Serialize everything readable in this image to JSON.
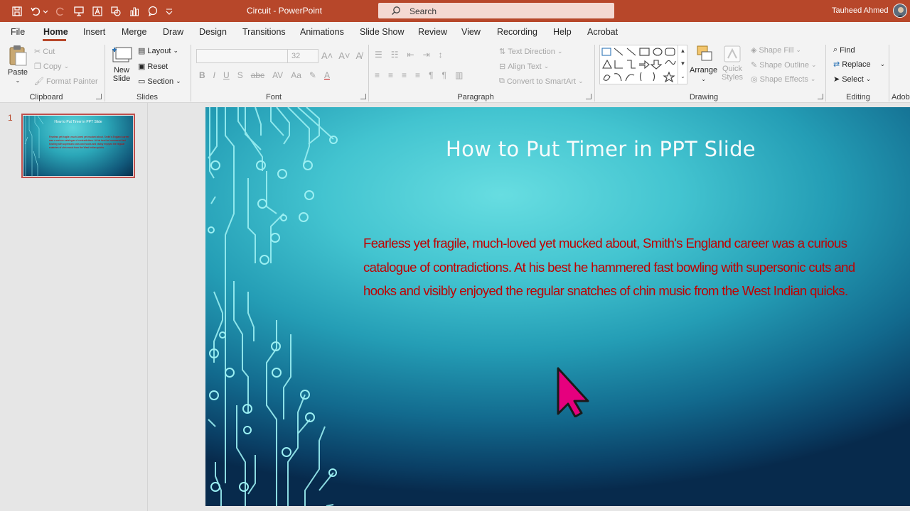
{
  "titlebar": {
    "doc_title": "Circuit  -  PowerPoint",
    "search_placeholder": "Search",
    "user_name": "Tauheed Ahmed"
  },
  "menu": {
    "tabs": [
      "File",
      "Home",
      "Insert",
      "Merge",
      "Draw",
      "Design",
      "Transitions",
      "Animations",
      "Slide Show",
      "Review",
      "View",
      "Recording",
      "Help",
      "Acrobat"
    ],
    "active": "Home"
  },
  "ribbon": {
    "clipboard": {
      "paste": "Paste",
      "cut": "Cut",
      "copy": "Copy",
      "format_painter": "Format Painter",
      "label": "Clipboard"
    },
    "slides": {
      "new_slide_1": "New",
      "new_slide_2": "Slide",
      "layout": "Layout",
      "reset": "Reset",
      "section": "Section",
      "label": "Slides"
    },
    "font": {
      "size": "32",
      "label": "Font"
    },
    "paragraph": {
      "text_direction": "Text Direction",
      "align_text": "Align Text",
      "convert_smartart": "Convert to SmartArt",
      "label": "Paragraph"
    },
    "drawing": {
      "arrange": "Arrange",
      "quick_styles_1": "Quick",
      "quick_styles_2": "Styles",
      "shape_fill": "Shape Fill",
      "shape_outline": "Shape Outline",
      "shape_effects": "Shape Effects",
      "label": "Drawing"
    },
    "editing": {
      "find": "Find",
      "replace": "Replace",
      "select": "Select",
      "label": "Editing"
    },
    "adobe": {
      "label": "Adobe"
    }
  },
  "thumbnails": [
    {
      "number": "1",
      "title": "How to Put Timer in PPT Slide"
    }
  ],
  "slide": {
    "title": "How to Put Timer in PPT Slide",
    "body": "Fearless yet fragile, much-loved yet mucked about, Smith's England career was a curious catalogue of contradictions. At his best he hammered fast bowling with supersonic cuts and hooks and visibly enjoyed the regular snatches of chin music from the West Indian quicks."
  },
  "colors": {
    "accent": "#b7472a",
    "body_text": "#c00000",
    "cursor": "#e6007e"
  }
}
